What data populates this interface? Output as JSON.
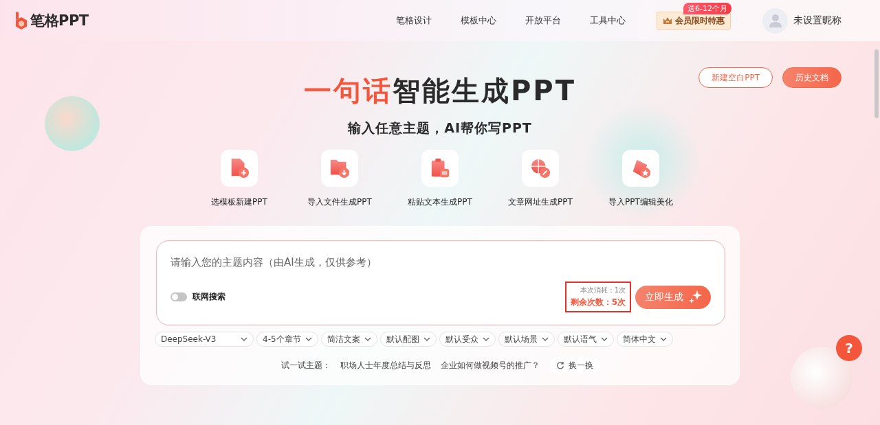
{
  "header": {
    "logo_text": "笔格PPT",
    "nav": [
      {
        "label": "笔格设计"
      },
      {
        "label": "模板中心"
      },
      {
        "label": "开放平台"
      },
      {
        "label": "工具中心"
      }
    ],
    "promo": {
      "label": "会员限时特惠",
      "badge": "送6-12个月"
    },
    "user": {
      "name": "未设置昵称"
    }
  },
  "top_buttons": [
    {
      "label": "新建空白PPT",
      "kind": "outline"
    },
    {
      "label": "历史文档",
      "kind": "filled"
    }
  ],
  "hero": {
    "title_highlight": "一句话",
    "title_rest": "智能生成PPT",
    "subtitle": "输入任意主题，AI帮你写PPT"
  },
  "actions": [
    {
      "label": "选模板新建PPT",
      "kind": "template"
    },
    {
      "label": "导入文件生成PPT",
      "kind": "file"
    },
    {
      "label": "粘贴文本生成PPT",
      "kind": "text"
    },
    {
      "label": "文章网址生成PPT",
      "kind": "url"
    },
    {
      "label": "导入PPT编辑美化",
      "kind": "beautify"
    }
  ],
  "composer": {
    "placeholder": "请输入您的主题内容（由AI生成，仅供参考）",
    "web_search": {
      "label": "联网搜索",
      "on": false
    },
    "quota": {
      "cost": "本次消耗：1次",
      "remaining": "剩余次数：5次",
      "outlined": true
    },
    "generate_button": "立即生成"
  },
  "options": [
    {
      "label": "DeepSeek-V3"
    },
    {
      "label": "4-5个章节"
    },
    {
      "label": "简洁文案"
    },
    {
      "label": "默认配图"
    },
    {
      "label": "默认受众"
    },
    {
      "label": "默认场景"
    },
    {
      "label": "默认语气"
    },
    {
      "label": "简体中文"
    }
  ],
  "suggestions": {
    "label": "试一试主题：",
    "topics": [
      "职场人士年度总结与反思",
      "企业如何做视频号的推广？"
    ],
    "refresh": "换一换"
  },
  "help_button": "?"
}
